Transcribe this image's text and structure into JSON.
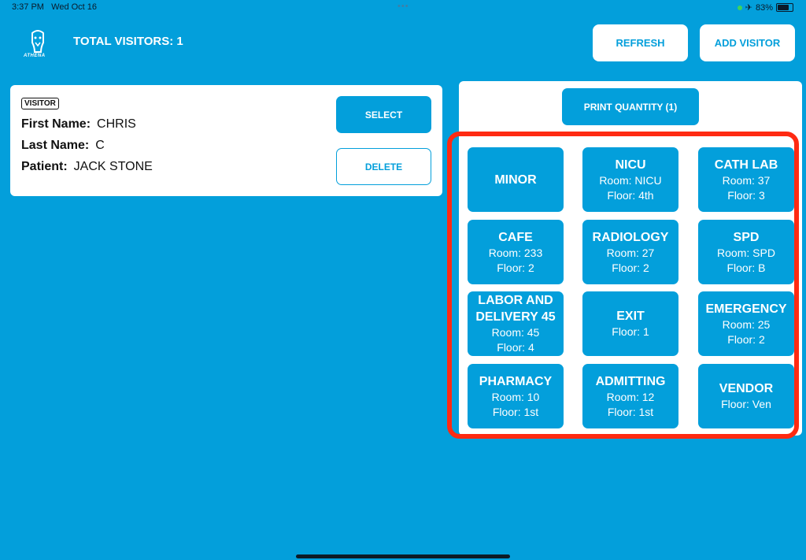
{
  "status": {
    "time": "3:37 PM",
    "date": "Wed Oct 16",
    "dots": "•••",
    "battery": "83%"
  },
  "header": {
    "logo_text": "ATHENA",
    "total_visitors": "TOTAL VISITORS: 1",
    "refresh_label": "REFRESH",
    "add_visitor_label": "ADD VISITOR"
  },
  "visitor": {
    "badge": "VISITOR",
    "first_name_label": "First Name:",
    "first_name": "CHRIS",
    "last_name_label": "Last Name:",
    "last_name": "C",
    "patient_label": "Patient:",
    "patient": "JACK STONE",
    "select_label": "SELECT",
    "delete_label": "DELETE"
  },
  "print": {
    "label": "PRINT QUANTITY (1)"
  },
  "locations": [
    {
      "title": "MINOR"
    },
    {
      "title": "NICU",
      "room": "Room: NICU",
      "floor": "Floor: 4th"
    },
    {
      "title": "CATH LAB",
      "room": "Room: 37",
      "floor": "Floor: 3"
    },
    {
      "title": "CAFE",
      "room": "Room: 233",
      "floor": "Floor: 2"
    },
    {
      "title": "RADIOLOGY",
      "room": "Room: 27",
      "floor": "Floor: 2"
    },
    {
      "title": "SPD",
      "room": "Room: SPD",
      "floor": "Floor: B"
    },
    {
      "title": "LABOR AND DELIVERY 45",
      "room": "Room: 45",
      "floor": "Floor: 4"
    },
    {
      "title": "EXIT",
      "floor": "Floor: 1"
    },
    {
      "title": "EMERGENCY",
      "room": "Room: 25",
      "floor": "Floor: 2"
    },
    {
      "title": "PHARMACY",
      "room": "Room: 10",
      "floor": "Floor: 1st"
    },
    {
      "title": "ADMITTING",
      "room": "Room: 12",
      "floor": "Floor: 1st"
    },
    {
      "title": "VENDOR",
      "floor": "Floor: Ven"
    }
  ],
  "colors": {
    "accent": "#039fdb",
    "highlight": "#ff2a12",
    "card": "#ffffff"
  }
}
